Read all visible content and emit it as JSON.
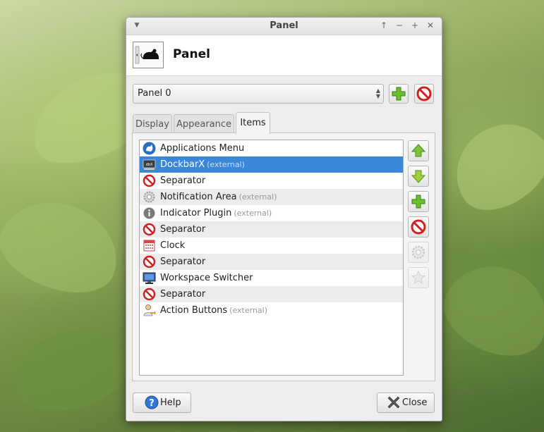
{
  "window": {
    "title": "Panel",
    "titlebar_buttons": [
      "menu-icon",
      "keep-above-icon",
      "minimize-icon",
      "maximize-icon",
      "close-icon"
    ]
  },
  "header": {
    "title": "Panel",
    "icon": "panel-mouse-icon"
  },
  "panel_selector": {
    "selected": "Panel 0"
  },
  "tabs": [
    {
      "label": "Display"
    },
    {
      "label": "Appearance"
    },
    {
      "label": "Items",
      "active": true
    }
  ],
  "items": [
    {
      "label": "Applications Menu",
      "external": "",
      "icon": "xfce-menu-icon"
    },
    {
      "label": "DockbarX",
      "external": "(external)",
      "icon": "dockbarx-icon",
      "selected": true
    },
    {
      "label": "Separator",
      "external": "",
      "icon": "no-entry-icon"
    },
    {
      "label": "Notification Area",
      "external": "(external)",
      "icon": "gear-icon"
    },
    {
      "label": "Indicator Plugin",
      "external": "(external)",
      "icon": "info-icon"
    },
    {
      "label": "Separator",
      "external": "",
      "icon": "no-entry-icon"
    },
    {
      "label": "Clock",
      "external": "",
      "icon": "calendar-icon"
    },
    {
      "label": "Separator",
      "external": "",
      "icon": "no-entry-icon"
    },
    {
      "label": "Workspace Switcher",
      "external": "",
      "icon": "monitor-icon"
    },
    {
      "label": "Separator",
      "external": "",
      "icon": "no-entry-icon"
    },
    {
      "label": "Action Buttons",
      "external": "(external)",
      "icon": "user-action-icon"
    }
  ],
  "side_buttons": [
    "move-up-icon",
    "move-down-icon",
    "add-icon",
    "remove-icon",
    "preferences-icon",
    "about-icon"
  ],
  "footer": {
    "help_label": "Help",
    "close_label": "Close"
  },
  "colors": {
    "selection": "#3a87d9",
    "add_green": "#6bbf2a",
    "remove_red": "#d31f1f"
  }
}
